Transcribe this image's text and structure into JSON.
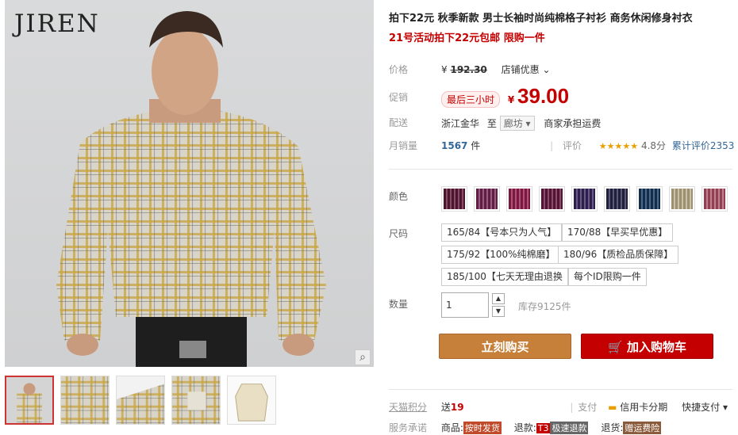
{
  "brand": "JIREN",
  "icons": {
    "zoom": "magnifier-icon",
    "cart": "cart-icon",
    "card": "credit-card-icon"
  },
  "product": {
    "title": "拍下22元 秋季新款 男士长袖时尚纯棉格子衬衫 商务休闲修身衬衣",
    "promo": "21号活动拍下22元包邮 限购一件"
  },
  "price": {
    "label": "价格",
    "currency": "¥",
    "original": "192.30",
    "store_discount": "店铺优惠",
    "promo_label": "促销",
    "promo_badge": "最后三小时",
    "promo_price": "39.00"
  },
  "shipping": {
    "label": "配送",
    "from": "浙江金华",
    "to_word": "至",
    "to": "廊坊",
    "note": "商家承担运费"
  },
  "sales": {
    "label": "月销量",
    "count": "1567",
    "unit": "件",
    "rating_label": "评价",
    "stars": "★★★★★",
    "score": "4.8分",
    "cumulative": "累计评价2353"
  },
  "color": {
    "label": "颜色",
    "swatches": [
      "#8a4a6a",
      "#9a5a82",
      "#b0507c",
      "#8e4a70",
      "#6a5a8a",
      "#5a5a7a",
      "#4a6a8a",
      "#c8c0a8",
      "#c08090"
    ]
  },
  "size": {
    "label": "尺码",
    "options": [
      "165/84【号本只为人气】",
      "170/88【早买早优惠】",
      "175/92【100%纯棉磨】",
      "180/96【质检品质保障】",
      "185/100【七天无理由退换",
      "每个ID限购一件"
    ]
  },
  "quantity": {
    "label": "数量",
    "value": "1",
    "stock": "库存9125件"
  },
  "buttons": {
    "buy": "立刻购买",
    "cart": "加入购物车"
  },
  "points": {
    "label": "天猫积分",
    "value_prefix": "送",
    "value": "19",
    "pay_label": "支付",
    "pay_card": "信用卡分期",
    "quick": "快捷支付"
  },
  "service": {
    "label": "服务承诺",
    "goods": "商品:",
    "goods_tag": "按时发货",
    "refund": "退款:",
    "refund_t3": "T3",
    "refund_tag": "极速退款",
    "return": "退货:",
    "return_tag": "赠运费险"
  }
}
